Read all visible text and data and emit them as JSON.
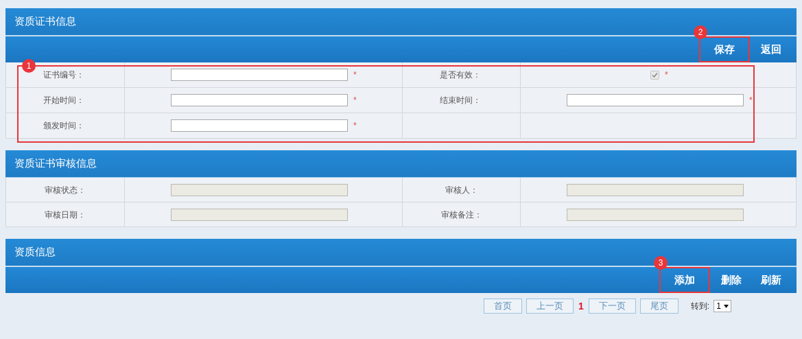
{
  "sections": [
    {
      "title": "资质证书信息",
      "annotation": "1",
      "centered_labels": false,
      "toolbar": [
        {
          "label": "保存",
          "annotation": "2"
        },
        {
          "label": "返回"
        }
      ],
      "rows": [
        [
          {
            "label": "证书编号：",
            "kind": "input",
            "disabled": false,
            "required_mark": "*"
          },
          {
            "label": "是否有效：",
            "kind": "checkbox",
            "checked": true,
            "required_mark": "*"
          }
        ],
        [
          {
            "label": "开始时间：",
            "kind": "input",
            "disabled": false,
            "required_mark": "*"
          },
          {
            "label": "结束时间：",
            "kind": "input",
            "disabled": false,
            "required_mark": "*"
          }
        ],
        [
          {
            "label": "颁发时间：",
            "kind": "input",
            "disabled": false,
            "required_mark": "*"
          }
        ]
      ]
    },
    {
      "title": "资质证书审核信息",
      "centered_labels": true,
      "rows": [
        [
          {
            "label": "审核状态：",
            "kind": "input",
            "disabled": true
          },
          {
            "label": "审核人：",
            "kind": "input",
            "disabled": true
          }
        ],
        [
          {
            "label": "审核日期：",
            "kind": "input",
            "disabled": true
          },
          {
            "label": "审核备注：",
            "kind": "input",
            "disabled": true
          }
        ]
      ]
    },
    {
      "title": "资质信息",
      "toolbar": [
        {
          "label": "添加",
          "annotation": "3"
        },
        {
          "label": "删除"
        },
        {
          "label": "刷新"
        }
      ],
      "pagination": {
        "before": [
          "首页",
          "上一页"
        ],
        "current": "1",
        "after": [
          "下一页",
          "尾页"
        ],
        "goto_label": "转到:",
        "goto_value": "1"
      }
    }
  ]
}
